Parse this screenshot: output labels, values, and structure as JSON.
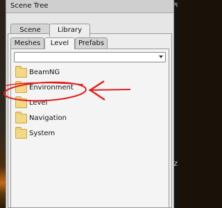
{
  "window": {
    "title": "Scene Tree"
  },
  "main_tabs": [
    {
      "label": "Scene",
      "active": false
    },
    {
      "label": "Library",
      "active": true
    }
  ],
  "sub_tabs": [
    {
      "label": "Meshes",
      "active": false
    },
    {
      "label": "Level",
      "active": true
    },
    {
      "label": "Prefabs",
      "active": false
    }
  ],
  "path_dropdown": {
    "value": ""
  },
  "folders": [
    {
      "label": "BeamNG",
      "icon": "folder-icon"
    },
    {
      "label": "Environment",
      "icon": "folder-icon",
      "highlighted": true
    },
    {
      "label": "Level",
      "icon": "folder-icon"
    },
    {
      "label": "Navigation",
      "icon": "folder-icon"
    },
    {
      "label": "System",
      "icon": "folder-icon"
    }
  ],
  "annotation": {
    "color": "#e02020"
  },
  "background_edge_text": {
    "top": "Pl",
    "middle": "Z"
  }
}
